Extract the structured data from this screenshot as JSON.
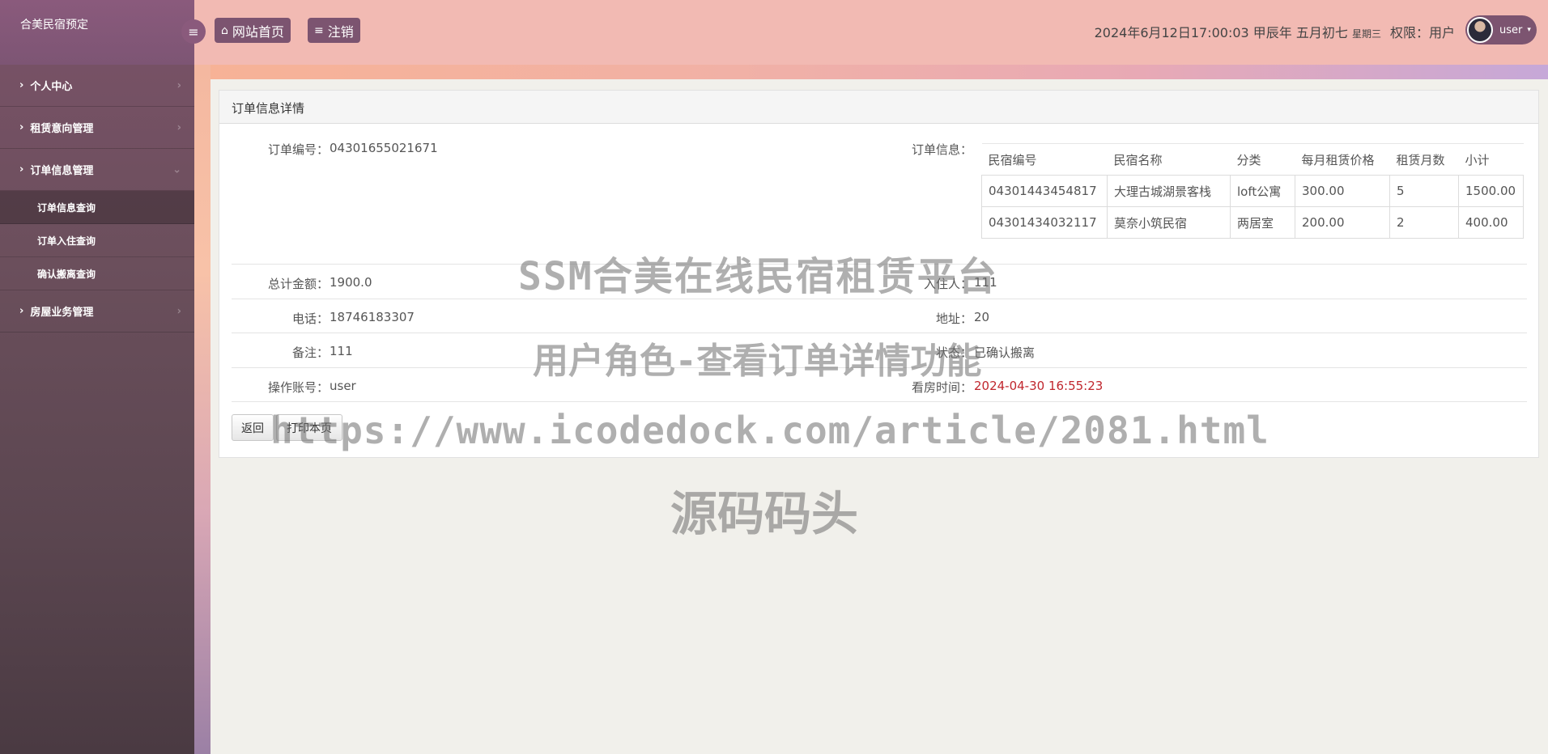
{
  "brand": "合美民宿预定",
  "sidebar": {
    "items": [
      {
        "label": "个人中心"
      },
      {
        "label": "租赁意向管理"
      },
      {
        "label": "订单信息管理"
      },
      {
        "label": "房屋业务管理"
      }
    ],
    "submenu": [
      {
        "label": "订单信息查询"
      },
      {
        "label": "订单入住查询"
      },
      {
        "label": "确认搬离查询"
      }
    ]
  },
  "header": {
    "home_label": "网站首页",
    "logout_label": "注销",
    "datetime": "2024年6月12日17:00:03 甲辰年 五月初七",
    "weekday": "星期三",
    "permission": "权限：用户",
    "username": "user"
  },
  "panel": {
    "title": "订单信息详情",
    "order_no_label": "订单编号：",
    "order_no": "04301655021671",
    "order_info_label": "订单信息：",
    "table": {
      "headers": [
        "民宿编号",
        "民宿名称",
        "分类",
        "每月租赁价格",
        "租赁月数",
        "小计"
      ],
      "rows": [
        [
          "04301443454817",
          "大理古城湖景客栈",
          "loft公寓",
          "300.00",
          "5",
          "1500.00"
        ],
        [
          "04301434032117",
          "莫奈小筑民宿",
          "两居室",
          "200.00",
          "2",
          "400.00"
        ]
      ]
    },
    "total_label": "总计金额：",
    "total": "1900.0",
    "occupant_label": "入住人：",
    "occupant": "111",
    "phone_label": "电话：",
    "phone": "18746183307",
    "address_label": "地址：",
    "address": "20",
    "remark_label": "备注：",
    "remark": "111",
    "status_label": "状态：",
    "status": "已确认搬离",
    "operator_label": "操作账号：",
    "operator": "user",
    "viewing_time_label": "看房时间：",
    "viewing_time": "2024-04-30 16:55:23",
    "back_label": "返回",
    "print_label": "打印本页"
  },
  "watermark": {
    "line1": "SSM合美在线民宿租赁平台",
    "line2": "用户角色-查看订单详情功能",
    "line3": "https://www.icodedock.com/article/2081.html",
    "line4": "源码码头"
  },
  "colors": {
    "sidebar": "#6b4f5c",
    "header": "#f2bab3",
    "accent_button": "#7c5470",
    "viewing_time": "#c0262d"
  }
}
